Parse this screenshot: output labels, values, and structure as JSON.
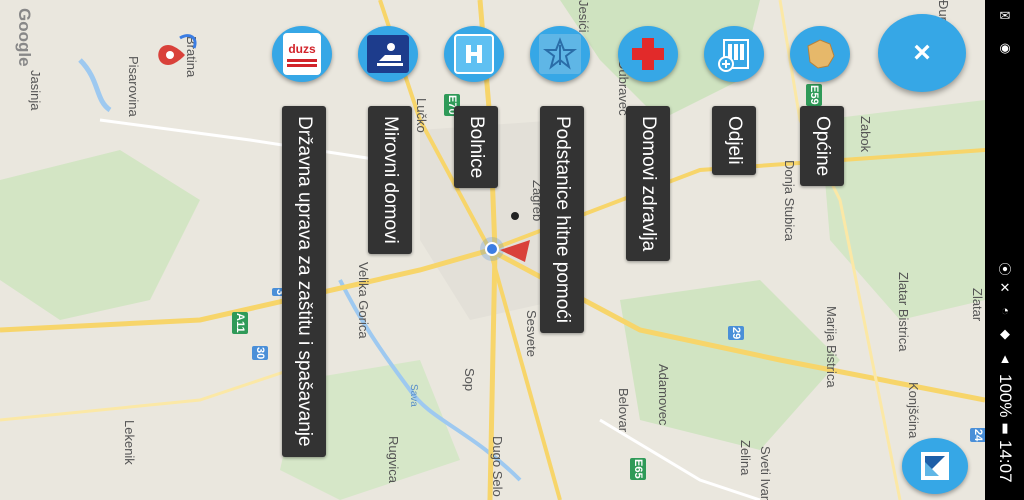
{
  "map": {
    "provider": "Google",
    "place_labels": [
      "Bratina",
      "Pisarovina",
      "Jasinja",
      "Lučko",
      "Zagreb",
      "Velika Gorica",
      "Sesvete",
      "Sop",
      "Rugvica",
      "Dugo Selo",
      "Lekenik",
      "Adamovec",
      "Belovar",
      "Dubravec",
      "Jesići",
      "Donja Stubica",
      "Marija Bistrica",
      "Zlatar Bistrica",
      "Zlatar",
      "Konjšćina",
      "Zabok",
      "Zelina",
      "Sveti Ivan",
      "Sava",
      "Đurmanec"
    ],
    "road_shields": [
      {
        "label": "E70",
        "color": "#2f9a58"
      },
      {
        "label": "E59",
        "color": "#2f9a58"
      },
      {
        "label": "E65",
        "color": "#2f9a58"
      },
      {
        "label": "29",
        "color": "#4a8fd8"
      },
      {
        "label": "30",
        "color": "#4a8fd8"
      },
      {
        "label": "A11",
        "color": "#2f9a58"
      },
      {
        "label": "3",
        "color": "#4a8fd8"
      },
      {
        "label": "24",
        "color": "#4a8fd8"
      }
    ]
  },
  "fab_menu": {
    "items": [
      {
        "label": "Državna uprava za zaštitu i spašavanje",
        "icon": "duzs-logo-icon"
      },
      {
        "label": "Mirovni domovi",
        "icon": "elderly-home-icon"
      },
      {
        "label": "Bolnice",
        "icon": "hospital-h-icon"
      },
      {
        "label": "Podstanice hitne pomoći",
        "icon": "ambulance-star-icon"
      },
      {
        "label": "Domovi zdravlja",
        "icon": "red-cross-icon"
      },
      {
        "label": "Odjeli",
        "icon": "departments-building-icon"
      },
      {
        "label": "Općine",
        "icon": "municipality-map-icon"
      }
    ],
    "close_label": "×",
    "duzs_text": "duzs"
  },
  "status_bar": {
    "time": "14:07",
    "battery": "100%"
  },
  "colors": {
    "fab": "#36a7e6",
    "label_bg": "#333333",
    "map_bg": "#eae7de"
  }
}
